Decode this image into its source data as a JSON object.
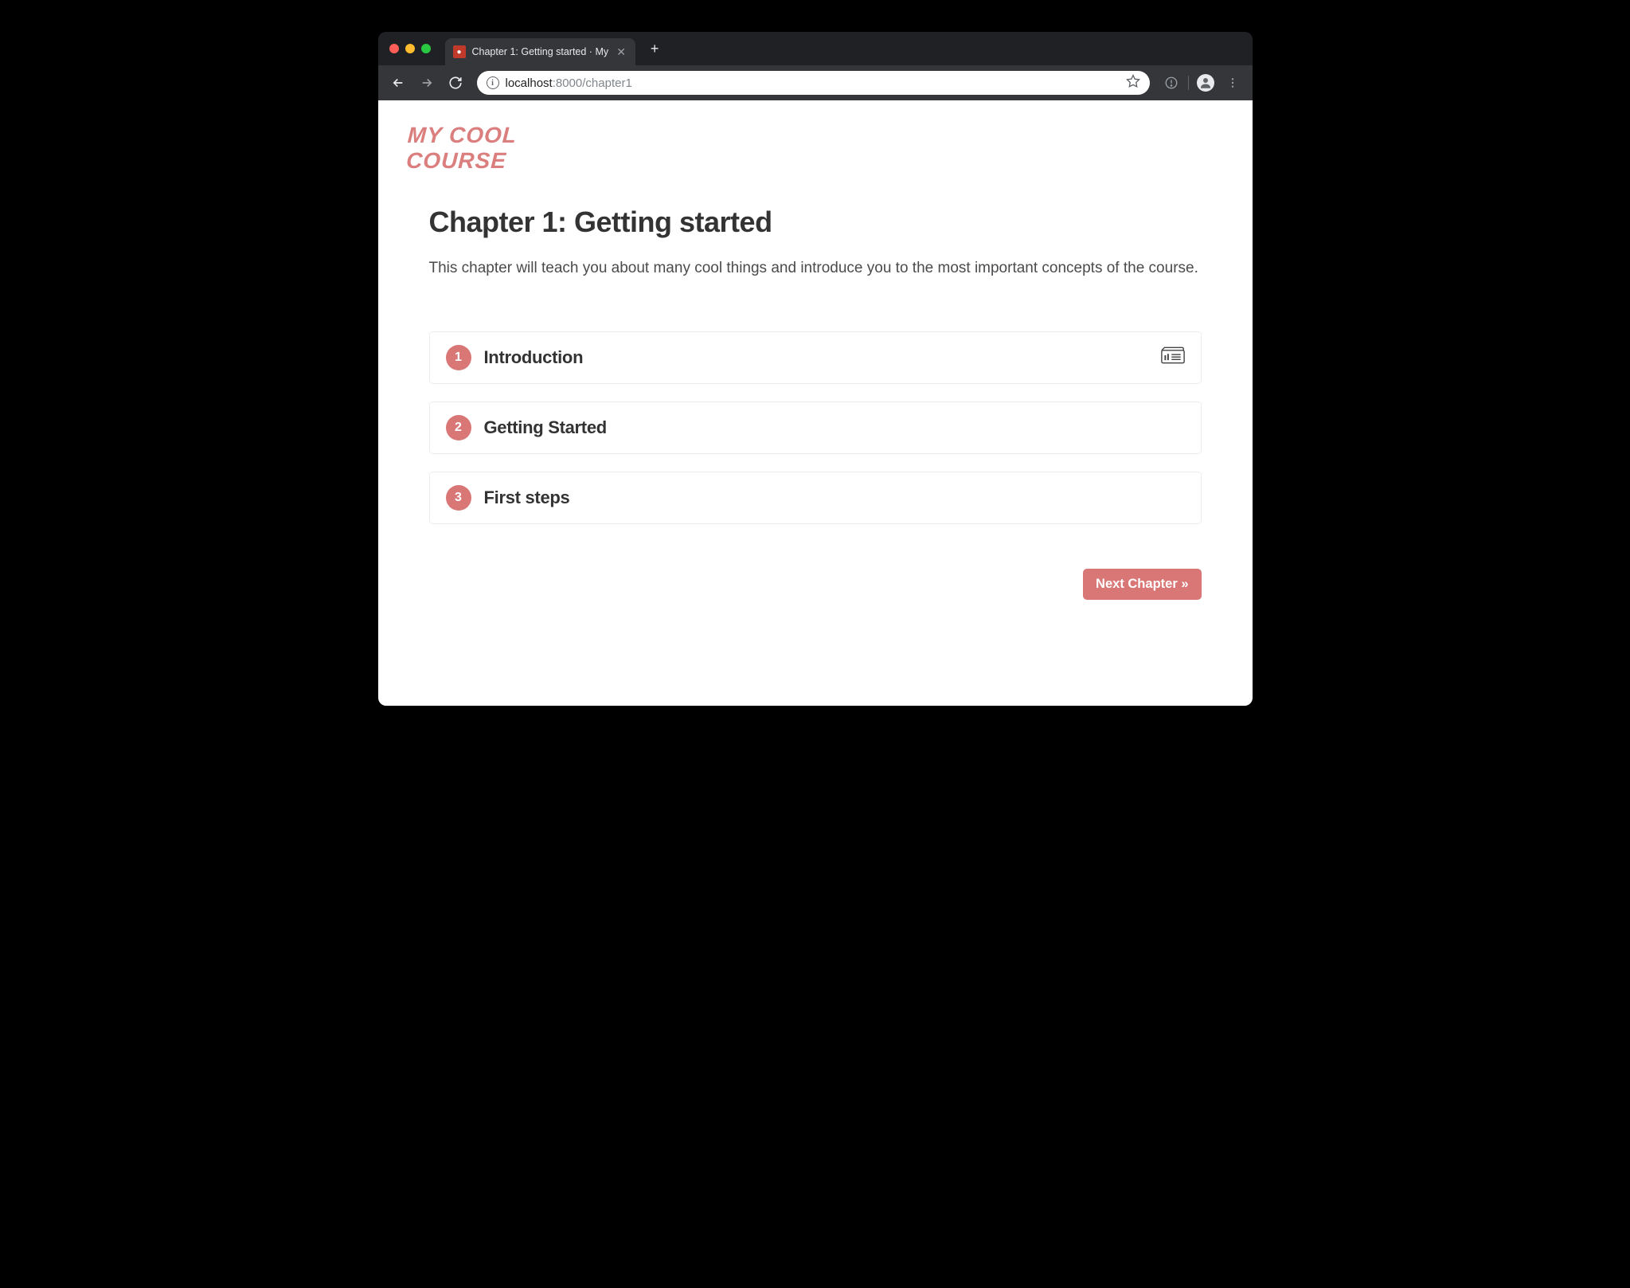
{
  "browser": {
    "tab_title": "Chapter 1: Getting started · My",
    "url_host": "localhost",
    "url_port": ":8000",
    "url_path": "/chapter1"
  },
  "site": {
    "logo_line1": "MY COOL",
    "logo_line2": "COURSE"
  },
  "page": {
    "title": "Chapter 1: Getting started",
    "description": "This chapter will teach you about many cool things and introduce you to the most important concepts of the course."
  },
  "lessons": [
    {
      "number": "1",
      "title": "Introduction",
      "has_slides": true
    },
    {
      "number": "2",
      "title": "Getting Started",
      "has_slides": false
    },
    {
      "number": "3",
      "title": "First steps",
      "has_slides": false
    }
  ],
  "nav": {
    "next_label": "Next Chapter »"
  },
  "colors": {
    "accent": "#d97676",
    "text_heading": "#333333"
  }
}
